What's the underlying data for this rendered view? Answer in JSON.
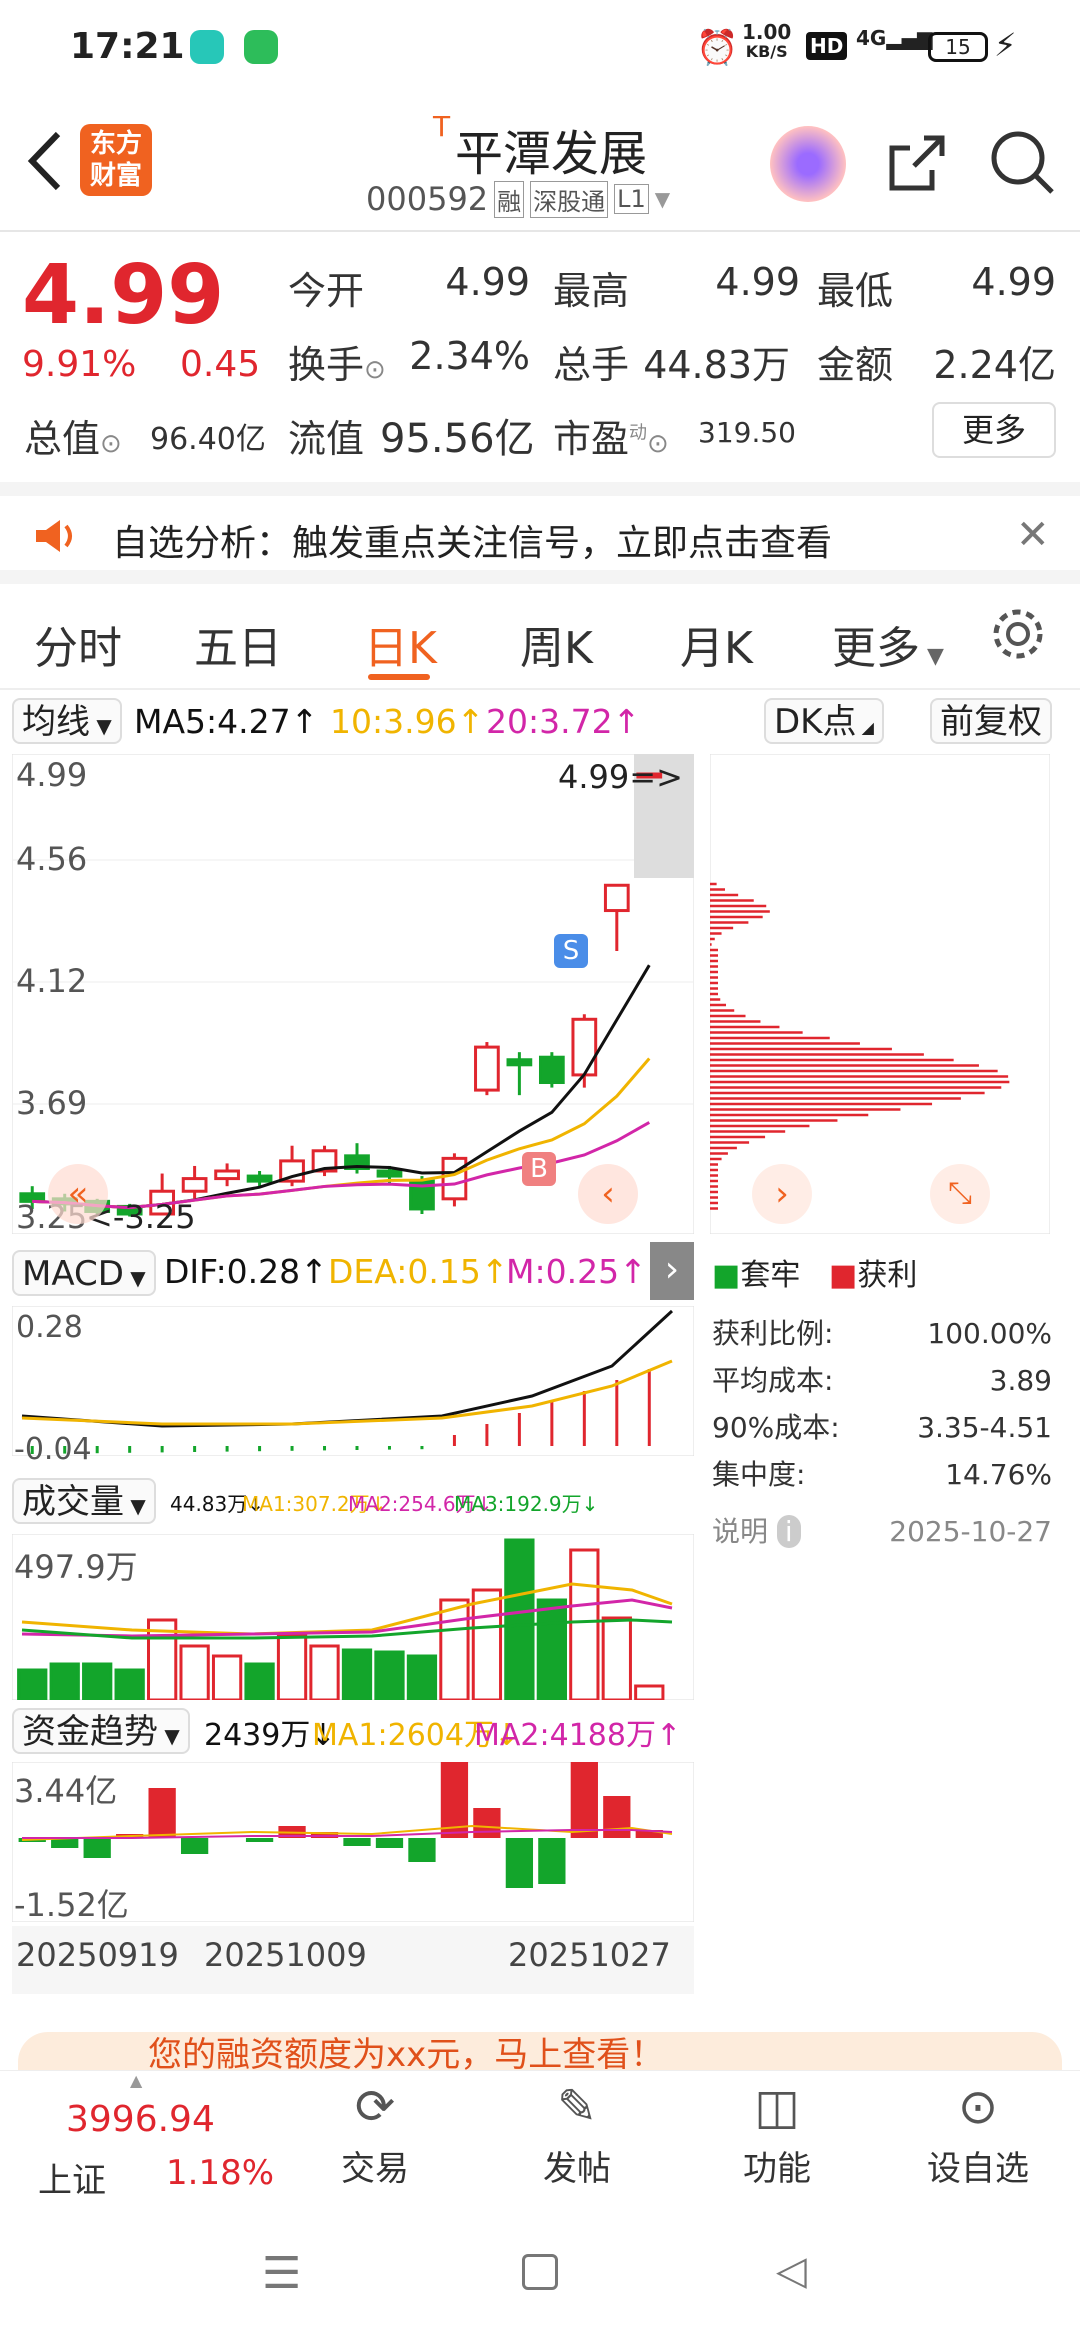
{
  "status": {
    "time": "17:21",
    "net_speed_top": "1.00",
    "net_speed_unit": "KB/S",
    "hd": "HD",
    "signal": "4G",
    "battery": "15"
  },
  "header": {
    "logo_line1": "东方",
    "logo_line2": "财富",
    "t_mark": "T",
    "stock_name": "平潭发展",
    "stock_code": "000592",
    "tags": [
      "融",
      "深股通",
      "L1"
    ]
  },
  "quote": {
    "price": "4.99",
    "change_pct": "9.91%",
    "change_amt": "0.45",
    "open_label": "今开",
    "open": "4.99",
    "high_label": "最高",
    "high": "4.99",
    "low_label": "最低",
    "low": "4.99",
    "turnover_label": "换手",
    "turnover": "2.34%",
    "volume_label": "总手",
    "volume": "44.83万",
    "amount_label": "金额",
    "amount": "2.24亿",
    "mktcap_label": "总值",
    "mktcap": "96.40亿",
    "float_label": "流值",
    "float_cap": "95.56亿",
    "pe_label": "市盈",
    "pe_sup": "动",
    "pe": "319.50",
    "more_button": "更多"
  },
  "banner": {
    "text": "自选分析：触发重点关注信号，立即点击查看"
  },
  "tabs": {
    "items": [
      "分时",
      "五日",
      "日K",
      "周K",
      "月K",
      "更多"
    ],
    "active": "日K"
  },
  "kline": {
    "ma_selector": "均线",
    "ma5": "MA5:4.27",
    "ma10": "10:3.96",
    "ma20": "20:3.72",
    "dk_button": "DK点",
    "adjust_button": "前复权",
    "y_labels": [
      "4.99",
      "4.56",
      "4.12",
      "3.69",
      "3.25"
    ],
    "price_marker": "4.99",
    "low_marker": "3.25",
    "sell_tag": "S",
    "buy_tag": "B",
    "colors": {
      "up": "#e0262e",
      "down": "#13a52b",
      "ma5": "#111111",
      "ma10": "#f0b400",
      "ma20": "#d226a8"
    },
    "candles": [
      {
        "o": 3.33,
        "c": 3.3,
        "h": 3.36,
        "l": 3.27
      },
      {
        "o": 3.31,
        "c": 3.29,
        "h": 3.33,
        "l": 3.26
      },
      {
        "o": 3.3,
        "c": 3.26,
        "h": 3.31,
        "l": 3.25
      },
      {
        "o": 3.28,
        "c": 3.25,
        "h": 3.29,
        "l": 3.24
      },
      {
        "o": 3.25,
        "c": 3.34,
        "h": 3.41,
        "l": 3.25
      },
      {
        "o": 3.34,
        "c": 3.39,
        "h": 3.44,
        "l": 3.31
      },
      {
        "o": 3.39,
        "c": 3.42,
        "h": 3.45,
        "l": 3.36
      },
      {
        "o": 3.4,
        "c": 3.38,
        "h": 3.42,
        "l": 3.36
      },
      {
        "o": 3.38,
        "c": 3.46,
        "h": 3.52,
        "l": 3.36
      },
      {
        "o": 3.42,
        "c": 3.5,
        "h": 3.52,
        "l": 3.4
      },
      {
        "o": 3.48,
        "c": 3.43,
        "h": 3.53,
        "l": 3.41
      },
      {
        "o": 3.42,
        "c": 3.4,
        "h": 3.44,
        "l": 3.37
      },
      {
        "o": 3.38,
        "c": 3.27,
        "h": 3.4,
        "l": 3.25
      },
      {
        "o": 3.31,
        "c": 3.47,
        "h": 3.49,
        "l": 3.28
      },
      {
        "o": 3.74,
        "c": 3.91,
        "h": 3.93,
        "l": 3.72
      },
      {
        "o": 3.86,
        "c": 3.84,
        "h": 3.89,
        "l": 3.72
      },
      {
        "o": 3.87,
        "c": 3.77,
        "h": 3.89,
        "l": 3.75
      },
      {
        "o": 3.8,
        "c": 4.02,
        "h": 4.04,
        "l": 3.75
      },
      {
        "o": 4.45,
        "c": 4.55,
        "h": 4.55,
        "l": 4.29
      },
      {
        "o": 4.99,
        "c": 4.99,
        "h": 4.99,
        "l": 4.99
      }
    ]
  },
  "chips": {
    "trapped_legend": "套牢",
    "profit_legend": "获利",
    "rows": [
      {
        "label": "获利比例:",
        "value": "100.00%"
      },
      {
        "label": "平均成本:",
        "value": "3.89"
      },
      {
        "label": "90%成本:",
        "value": "3.35-4.51"
      },
      {
        "label": "集中度:",
        "value": "14.76%"
      }
    ],
    "note_label": "说明",
    "date": "2025-10-27"
  },
  "macd": {
    "selector": "MACD",
    "dif": "DIF:0.28",
    "dea": "DEA:0.15",
    "m": "M:0.25",
    "y_top": "0.28",
    "y_bottom": "-0.04"
  },
  "volume": {
    "selector": "成交量",
    "vol": "44.83万",
    "ma1": "MA1:307.2万",
    "ma2": "MA2:254.6万",
    "ma3": "MA3:192.9万",
    "y_top": "497.9万"
  },
  "fund": {
    "selector": "资金趋势",
    "val": "2439万",
    "ma1": "MA1:2604万",
    "ma2": "MA2:4188万",
    "y_top": "3.44亿",
    "y_bottom": "-1.52亿",
    "dates": [
      "20250919",
      "20251009",
      "20251027"
    ]
  },
  "promo": {
    "text": "您的融资额度为xx元，马上查看！"
  },
  "bottom_nav": {
    "index_value": "3996.94",
    "index_name": "上证",
    "index_pct": "1.18%",
    "items": [
      "交易",
      "发帖",
      "功能",
      "设自选"
    ]
  }
}
